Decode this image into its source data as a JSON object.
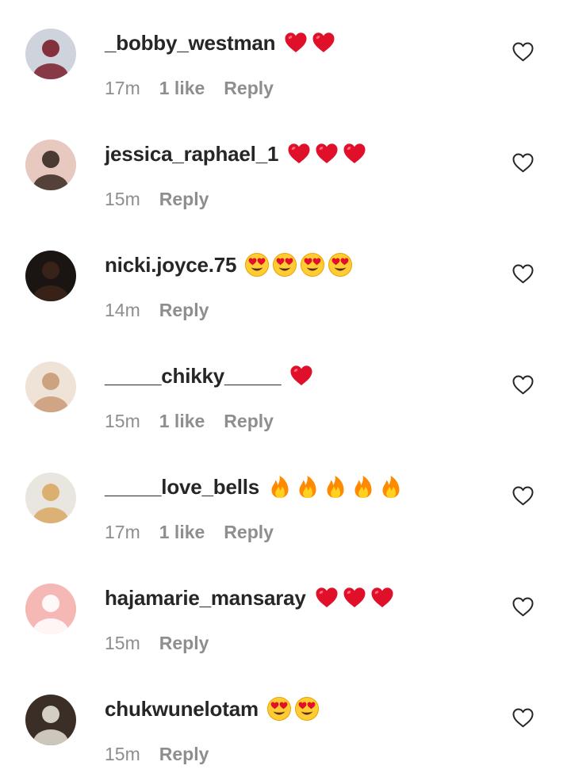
{
  "comments": [
    {
      "username": "_bobby_westman",
      "emojis": [
        "red-heart",
        "red-heart"
      ],
      "time": "17m",
      "likes": "1 like",
      "reply": "Reply",
      "avatar_colors": [
        "#cfd4dc",
        "#7a1f2b"
      ]
    },
    {
      "username": "jessica_raphael_1",
      "emojis": [
        "red-heart",
        "red-heart",
        "red-heart"
      ],
      "time": "15m",
      "reply": "Reply",
      "avatar_colors": [
        "#e8c9c0",
        "#3a2a22"
      ]
    },
    {
      "username": "nicki.joyce.75",
      "emojis": [
        "heart-eyes",
        "heart-eyes",
        "heart-eyes",
        "heart-eyes"
      ],
      "time": "14m",
      "reply": "Reply",
      "avatar_colors": [
        "#1a1412",
        "#3d2419"
      ]
    },
    {
      "username": "_____chikky_____",
      "emojis": [
        "red-heart"
      ],
      "time": "15m",
      "likes": "1 like",
      "reply": "Reply",
      "avatar_colors": [
        "#efe3d8",
        "#c99a78"
      ]
    },
    {
      "username": "_____love_bells",
      "emojis": [
        "fire",
        "fire",
        "fire",
        "fire",
        "fire"
      ],
      "time": "17m",
      "likes": "1 like",
      "reply": "Reply",
      "avatar_colors": [
        "#e9e5df",
        "#d9a864"
      ]
    },
    {
      "username": "hajamarie_mansaray",
      "emojis": [
        "red-heart",
        "red-heart",
        "red-heart"
      ],
      "time": "15m",
      "reply": "Reply",
      "avatar_colors": [
        "#f6b8b4",
        "#ffffff"
      ]
    },
    {
      "username": "chukwunelotam",
      "emojis": [
        "heart-eyes",
        "heart-eyes"
      ],
      "time": "15m",
      "reply": "Reply",
      "avatar_colors": [
        "#3a2e26",
        "#e6e1d8"
      ]
    }
  ],
  "colors": {
    "username": "#262626",
    "meta": "#8e8e8e",
    "heart": "#e0102b",
    "fire": "#ff8a00",
    "heart_eyes_face": "#ffcc33"
  }
}
